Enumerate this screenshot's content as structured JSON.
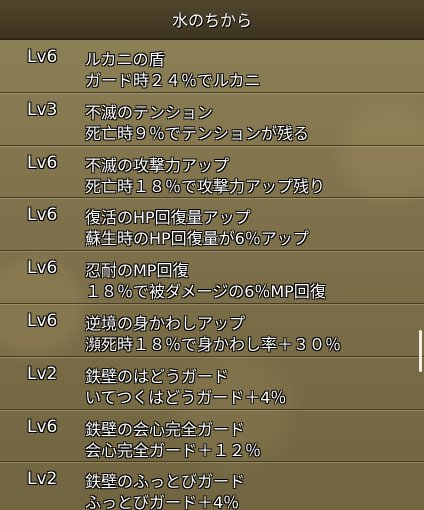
{
  "header": {
    "title": "水のちから"
  },
  "skills": [
    {
      "level": "Lv6",
      "name": "ルカニの盾",
      "desc": "ガード時２４％でルカニ"
    },
    {
      "level": "Lv3",
      "name": "不滅のテンション",
      "desc": "死亡時９％でテンションが残る"
    },
    {
      "level": "Lv6",
      "name": "不滅の攻撃力アップ",
      "desc": "死亡時１８％で攻撃力アップ残り"
    },
    {
      "level": "Lv6",
      "name": "復活のHP回復量アップ",
      "desc": "蘇生時のHP回復量が6％アップ"
    },
    {
      "level": "Lv6",
      "name": "忍耐のMP回復",
      "desc": "１８％で被ダメージの6％MP回復"
    },
    {
      "level": "Lv6",
      "name": "逆境の身かわしアップ",
      "desc": "瀕死時１８％で身かわし率＋３０％"
    },
    {
      "level": "Lv2",
      "name": "鉄壁のはどうガード",
      "desc": "いてつくはどうガード＋4％"
    },
    {
      "level": "Lv6",
      "name": "鉄壁の会心完全ガード",
      "desc": "会心完全ガード＋１２％"
    },
    {
      "level": "Lv2",
      "name": "鉄壁のふっとびガード",
      "desc": "ふっとびガード＋4％"
    }
  ]
}
